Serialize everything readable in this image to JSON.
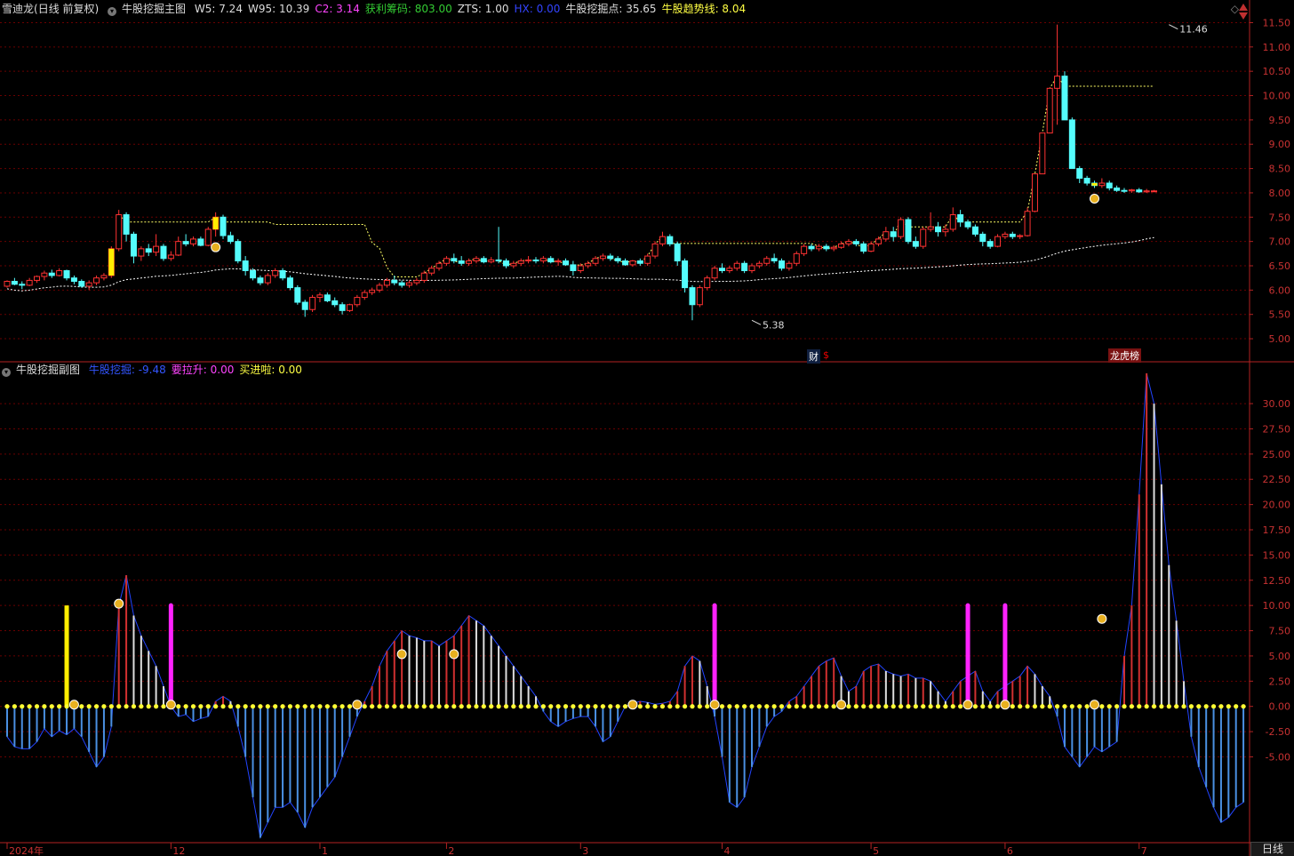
{
  "main_header": {
    "stock_label": "雪迪龙",
    "mode_label": "(日线 前复权)",
    "indicator_name": "牛股挖掘主图",
    "values": [
      {
        "text": "W5: 7.24",
        "color": "#dddddd"
      },
      {
        "text": "W95: 10.39",
        "color": "#dddddd"
      },
      {
        "text": "C2: 3.14",
        "color": "#ff44ff"
      },
      {
        "text": "获利筹码: 803.00",
        "color": "#33cc33"
      },
      {
        "text": "ZTS: 1.00",
        "color": "#dddddd"
      },
      {
        "text": "HX: 0.00",
        "color": "#3344ff"
      },
      {
        "text": "牛股挖掘点: 35.65",
        "color": "#dddddd"
      },
      {
        "text": "牛股趋势线: 8.04",
        "color": "#ffff44"
      }
    ]
  },
  "sub_header": {
    "indicator_name": "牛股挖掘副图",
    "values": [
      {
        "text": "牛股挖掘: -9.48",
        "color": "#3355ff"
      },
      {
        "text": "要拉升: 0.00",
        "color": "#ff44ff"
      },
      {
        "text": "买进啦: 0.00",
        "color": "#ffff44"
      }
    ]
  },
  "badges": {
    "cai": "财",
    "cai2": "$",
    "lhb": "龙虎榜"
  },
  "bottom_tab": "日线",
  "colors": {
    "up": "#ff3232",
    "down": "#54fcfc",
    "grid": "#6a0000",
    "axis": "#b22222",
    "dot": "#ffff33",
    "magenta": "#ff22ff",
    "blue_line": "#2244ff"
  },
  "chart_data": [
    {
      "type": "candlestick",
      "title": "牛股挖掘主图",
      "ylim": [
        4.8,
        11.6
      ],
      "y_ticks": [
        5.0,
        5.5,
        6.0,
        6.5,
        7.0,
        7.5,
        8.0,
        8.5,
        9.0,
        9.5,
        10.0,
        10.5,
        11.0,
        11.5
      ],
      "x_labels": [
        "2024年",
        "12",
        "1",
        "2",
        "3",
        "4",
        "5",
        "6",
        "7"
      ],
      "x_label_index": [
        0,
        22,
        42,
        59,
        77,
        96,
        116,
        134,
        152
      ],
      "annotations": [
        {
          "text": "11.46",
          "index": 156,
          "value": 11.46
        },
        {
          "text": "5.38",
          "index": 100,
          "value": 5.38
        }
      ],
      "ohlc": [
        [
          6.08,
          6.2,
          6.05,
          6.18
        ],
        [
          6.18,
          6.25,
          6.1,
          6.12
        ],
        [
          6.12,
          6.18,
          6.02,
          6.1
        ],
        [
          6.1,
          6.25,
          6.08,
          6.2
        ],
        [
          6.2,
          6.3,
          6.15,
          6.28
        ],
        [
          6.28,
          6.4,
          6.2,
          6.35
        ],
        [
          6.35,
          6.42,
          6.25,
          6.3
        ],
        [
          6.3,
          6.45,
          6.28,
          6.4
        ],
        [
          6.4,
          6.42,
          6.2,
          6.25
        ],
        [
          6.25,
          6.3,
          6.12,
          6.18
        ],
        [
          6.18,
          6.22,
          6.05,
          6.08
        ],
        [
          6.08,
          6.2,
          6.0,
          6.15
        ],
        [
          6.15,
          6.3,
          6.1,
          6.25
        ],
        [
          6.25,
          6.35,
          6.2,
          6.3
        ],
        [
          6.3,
          6.9,
          6.25,
          6.85
        ],
        [
          6.85,
          7.65,
          6.8,
          7.55
        ],
        [
          7.55,
          7.6,
          7.0,
          7.15
        ],
        [
          7.15,
          7.2,
          6.55,
          6.7
        ],
        [
          6.7,
          6.9,
          6.6,
          6.85
        ],
        [
          6.85,
          6.95,
          6.7,
          6.78
        ],
        [
          6.78,
          7.15,
          6.7,
          6.9
        ],
        [
          6.9,
          6.95,
          6.6,
          6.65
        ],
        [
          6.65,
          6.8,
          6.6,
          6.72
        ],
        [
          6.72,
          7.1,
          6.7,
          7.0
        ],
        [
          7.0,
          7.15,
          6.9,
          6.95
        ],
        [
          6.95,
          7.1,
          6.9,
          7.05
        ],
        [
          7.05,
          7.1,
          6.9,
          6.92
        ],
        [
          6.92,
          7.3,
          6.9,
          7.25
        ],
        [
          7.25,
          7.6,
          7.1,
          7.5
        ],
        [
          7.5,
          7.55,
          7.05,
          7.12
        ],
        [
          7.12,
          7.2,
          6.95,
          7.0
        ],
        [
          7.0,
          7.05,
          6.55,
          6.6
        ],
        [
          6.6,
          6.7,
          6.3,
          6.4
        ],
        [
          6.4,
          6.45,
          6.2,
          6.25
        ],
        [
          6.25,
          6.3,
          6.1,
          6.15
        ],
        [
          6.15,
          6.35,
          6.1,
          6.3
        ],
        [
          6.3,
          6.45,
          6.25,
          6.4
        ],
        [
          6.4,
          6.45,
          6.2,
          6.25
        ],
        [
          6.25,
          6.3,
          6.0,
          6.05
        ],
        [
          6.05,
          6.1,
          5.7,
          5.75
        ],
        [
          5.75,
          5.8,
          5.45,
          5.6
        ],
        [
          5.6,
          5.9,
          5.55,
          5.85
        ],
        [
          5.85,
          5.95,
          5.75,
          5.9
        ],
        [
          5.9,
          5.95,
          5.75,
          5.78
        ],
        [
          5.78,
          5.85,
          5.65,
          5.7
        ],
        [
          5.7,
          5.75,
          5.5,
          5.58
        ],
        [
          5.58,
          5.72,
          5.55,
          5.7
        ],
        [
          5.7,
          5.9,
          5.65,
          5.85
        ],
        [
          5.85,
          6.0,
          5.8,
          5.95
        ],
        [
          5.95,
          6.05,
          5.9,
          6.0
        ],
        [
          6.0,
          6.15,
          5.95,
          6.1
        ],
        [
          6.1,
          6.25,
          6.05,
          6.2
        ],
        [
          6.2,
          6.3,
          6.1,
          6.15
        ],
        [
          6.15,
          6.2,
          6.05,
          6.1
        ],
        [
          6.1,
          6.2,
          6.05,
          6.15
        ],
        [
          6.15,
          6.25,
          6.1,
          6.2
        ],
        [
          6.2,
          6.4,
          6.15,
          6.35
        ],
        [
          6.35,
          6.5,
          6.3,
          6.45
        ],
        [
          6.45,
          6.6,
          6.4,
          6.55
        ],
        [
          6.55,
          6.7,
          6.5,
          6.65
        ],
        [
          6.65,
          6.75,
          6.55,
          6.6
        ],
        [
          6.6,
          6.7,
          6.5,
          6.55
        ],
        [
          6.55,
          6.65,
          6.5,
          6.6
        ],
        [
          6.6,
          6.7,
          6.55,
          6.65
        ],
        [
          6.65,
          6.7,
          6.55,
          6.58
        ],
        [
          6.58,
          6.68,
          6.55,
          6.62
        ],
        [
          6.62,
          7.3,
          6.55,
          6.6
        ],
        [
          6.6,
          6.65,
          6.45,
          6.5
        ],
        [
          6.5,
          6.6,
          6.45,
          6.55
        ],
        [
          6.55,
          6.65,
          6.5,
          6.6
        ],
        [
          6.6,
          6.7,
          6.55,
          6.62
        ],
        [
          6.62,
          6.68,
          6.55,
          6.6
        ],
        [
          6.6,
          6.7,
          6.55,
          6.65
        ],
        [
          6.65,
          6.7,
          6.55,
          6.58
        ],
        [
          6.58,
          6.65,
          6.5,
          6.6
        ],
        [
          6.6,
          6.65,
          6.5,
          6.52
        ],
        [
          6.52,
          6.6,
          6.3,
          6.4
        ],
        [
          6.4,
          6.55,
          6.35,
          6.5
        ],
        [
          6.5,
          6.6,
          6.45,
          6.55
        ],
        [
          6.55,
          6.7,
          6.5,
          6.65
        ],
        [
          6.65,
          6.75,
          6.6,
          6.7
        ],
        [
          6.7,
          6.75,
          6.6,
          6.65
        ],
        [
          6.65,
          6.7,
          6.55,
          6.6
        ],
        [
          6.6,
          6.65,
          6.5,
          6.52
        ],
        [
          6.52,
          6.62,
          6.48,
          6.6
        ],
        [
          6.6,
          6.65,
          6.5,
          6.55
        ],
        [
          6.55,
          6.75,
          6.5,
          6.7
        ],
        [
          6.7,
          7.0,
          6.65,
          6.95
        ],
        [
          6.95,
          7.2,
          6.9,
          7.1
        ],
        [
          7.1,
          7.15,
          6.9,
          6.95
        ],
        [
          6.95,
          7.0,
          6.5,
          6.6
        ],
        [
          6.6,
          6.65,
          5.95,
          6.05
        ],
        [
          6.05,
          6.1,
          5.38,
          5.7
        ],
        [
          5.7,
          6.1,
          5.65,
          6.05
        ],
        [
          6.05,
          6.3,
          6.0,
          6.25
        ],
        [
          6.25,
          6.5,
          6.2,
          6.45
        ],
        [
          6.45,
          6.55,
          6.35,
          6.4
        ],
        [
          6.4,
          6.5,
          6.35,
          6.45
        ],
        [
          6.45,
          6.6,
          6.4,
          6.55
        ],
        [
          6.55,
          6.6,
          6.35,
          6.4
        ],
        [
          6.4,
          6.55,
          6.35,
          6.5
        ],
        [
          6.5,
          6.6,
          6.45,
          6.55
        ],
        [
          6.55,
          6.7,
          6.5,
          6.65
        ],
        [
          6.65,
          6.75,
          6.55,
          6.6
        ],
        [
          6.6,
          6.65,
          6.4,
          6.45
        ],
        [
          6.45,
          6.6,
          6.4,
          6.55
        ],
        [
          6.55,
          6.8,
          6.5,
          6.75
        ],
        [
          6.75,
          6.95,
          6.7,
          6.9
        ],
        [
          6.9,
          6.95,
          6.8,
          6.85
        ],
        [
          6.85,
          6.95,
          6.8,
          6.9
        ],
        [
          6.9,
          6.95,
          6.8,
          6.85
        ],
        [
          6.85,
          6.92,
          6.8,
          6.88
        ],
        [
          6.88,
          7.0,
          6.85,
          6.95
        ],
        [
          6.95,
          7.05,
          6.9,
          7.0
        ],
        [
          7.0,
          7.05,
          6.9,
          6.95
        ],
        [
          6.95,
          7.0,
          6.75,
          6.8
        ],
        [
          6.8,
          7.0,
          6.78,
          6.95
        ],
        [
          6.95,
          7.1,
          6.9,
          7.05
        ],
        [
          7.05,
          7.3,
          7.0,
          7.2
        ],
        [
          7.2,
          7.3,
          7.0,
          7.1
        ],
        [
          7.1,
          7.5,
          7.05,
          7.45
        ],
        [
          7.45,
          7.5,
          6.95,
          7.0
        ],
        [
          7.0,
          7.1,
          6.85,
          6.9
        ],
        [
          6.9,
          7.3,
          6.85,
          7.25
        ],
        [
          7.25,
          7.6,
          7.2,
          7.3
        ],
        [
          7.3,
          7.4,
          7.1,
          7.2
        ],
        [
          7.2,
          7.35,
          7.1,
          7.25
        ],
        [
          7.25,
          7.7,
          7.2,
          7.55
        ],
        [
          7.55,
          7.65,
          7.3,
          7.4
        ],
        [
          7.4,
          7.45,
          7.25,
          7.3
        ],
        [
          7.3,
          7.35,
          7.1,
          7.15
        ],
        [
          7.15,
          7.2,
          6.9,
          7.0
        ],
        [
          7.0,
          7.05,
          6.85,
          6.9
        ],
        [
          6.9,
          7.15,
          6.88,
          7.1
        ],
        [
          7.1,
          7.2,
          7.05,
          7.15
        ],
        [
          7.15,
          7.2,
          7.05,
          7.1
        ],
        [
          7.1,
          7.15,
          7.05,
          7.12
        ],
        [
          7.12,
          7.7,
          7.1,
          7.62
        ],
        [
          7.62,
          8.39,
          7.6,
          8.39
        ],
        [
          8.39,
          9.23,
          8.39,
          9.23
        ],
        [
          9.23,
          10.15,
          9.23,
          10.15
        ],
        [
          10.15,
          11.46,
          9.4,
          10.4
        ],
        [
          10.4,
          10.5,
          9.5,
          9.5
        ],
        [
          9.5,
          9.55,
          8.5,
          8.5
        ],
        [
          8.5,
          8.55,
          8.2,
          8.3
        ],
        [
          8.3,
          8.35,
          8.15,
          8.2
        ],
        [
          8.2,
          8.25,
          8.1,
          8.15
        ],
        [
          8.15,
          8.3,
          8.1,
          8.2
        ],
        [
          8.2,
          8.25,
          8.05,
          8.1
        ],
        [
          8.1,
          8.15,
          8.02,
          8.05
        ],
        [
          8.05,
          8.1,
          8.0,
          8.04
        ],
        [
          8.04,
          8.08,
          8.0,
          8.06
        ],
        [
          8.06,
          8.1,
          8.0,
          8.02
        ],
        [
          8.02,
          8.08,
          8.0,
          8.04
        ],
        [
          8.04,
          8.06,
          8.02,
          8.04
        ]
      ],
      "series_labels": {
        "upper_line": "W95",
        "lower_line": "牛股趋势线"
      }
    },
    {
      "type": "bar",
      "title": "牛股挖掘副图",
      "ylim": [
        -13.5,
        33
      ],
      "y_ticks": [
        -5.0,
        -2.5,
        0.0,
        2.5,
        5.0,
        7.5,
        10.0,
        12.5,
        15.0,
        17.5,
        20.0,
        22.5,
        25.0,
        27.5,
        30.0
      ],
      "series": [
        {
          "name": "牛股挖掘",
          "values": [
            -3.0,
            -4.0,
            -4.2,
            -4.2,
            -3.5,
            -2.2,
            -3.0,
            -2.4,
            -2.8,
            -2.2,
            -3.0,
            -4.5,
            -6.0,
            -5.0,
            -2.0,
            10.0,
            13.0,
            9.0,
            7.0,
            5.5,
            4.0,
            2.0,
            0.0,
            -1.0,
            -0.8,
            -1.5,
            -1.2,
            -1.0,
            0.5,
            1.0,
            0.5,
            -2.0,
            -5.0,
            -9.0,
            -13.0,
            -11.5,
            -10.0,
            -10.0,
            -9.5,
            -10.5,
            -12.0,
            -10.0,
            -9.0,
            -8.0,
            -7.0,
            -5.0,
            -3.0,
            -1.0,
            0.5,
            2.0,
            4.0,
            5.5,
            6.5,
            7.5,
            7.0,
            6.8,
            6.5,
            6.5,
            6.0,
            6.5,
            7.0,
            8.0,
            9.0,
            8.5,
            8.0,
            7.0,
            6.0,
            5.0,
            4.0,
            3.0,
            2.0,
            1.0,
            -0.5,
            -1.5,
            -2.0,
            -1.5,
            -1.2,
            -1.0,
            -1.0,
            -2.0,
            -3.5,
            -3.0,
            -1.5,
            0.0,
            0.3,
            0.5,
            0.4,
            0.2,
            0.3,
            0.5,
            1.5,
            4.0,
            5.0,
            4.5,
            2.0,
            -1.0,
            -5.0,
            -9.5,
            -10.0,
            -9.0,
            -6.0,
            -4.0,
            -2.0,
            -1.0,
            -0.5,
            0.5,
            1.0,
            2.0,
            3.0,
            4.0,
            4.5,
            4.8,
            3.0,
            1.5,
            2.0,
            3.5,
            4.0,
            4.2,
            3.5,
            3.2,
            3.0,
            3.2,
            2.8,
            2.8,
            2.5,
            1.5,
            0.5,
            1.5,
            2.5,
            3.0,
            3.5,
            1.5,
            0.5,
            1.5,
            2.0,
            2.5,
            3.0,
            4.0,
            3.2,
            2.0,
            1.0,
            -1.0,
            -4.0,
            -5.0,
            -6.0,
            -5.0,
            -4.0,
            -4.5,
            -4.0,
            -3.5,
            5.0,
            10.0,
            21.0,
            33.0,
            30.0,
            22.0,
            14.0,
            8.5,
            2.5,
            -3.0,
            -6.0,
            -8.0,
            -10.0,
            -11.5,
            -11.0,
            -10.0,
            -9.5
          ]
        },
        {
          "name": "要拉升",
          "signal_index": [
            22,
            95,
            129,
            134
          ],
          "value": 10
        },
        {
          "name": "买进啦",
          "signal_index": [
            8
          ],
          "value": 10
        }
      ]
    }
  ]
}
